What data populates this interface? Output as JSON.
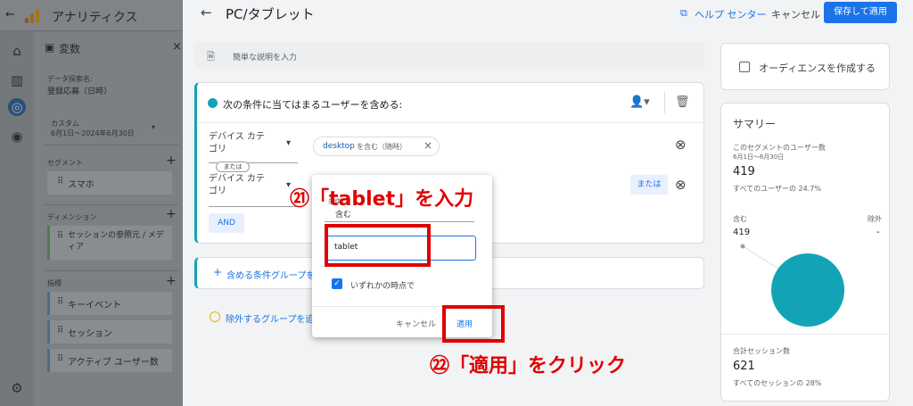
{
  "app": {
    "back_glyph": "←",
    "title": "アナリティクス",
    "variables_title": "変数",
    "close_glyph": "×",
    "dataset_label": "データ探索名:",
    "dataset_value": "登録応募（日時）",
    "custom_label": "カスタム",
    "date_range": "6月1日～2024年6月30日",
    "segments_label": "セグメント",
    "segment_item": "スマホ",
    "dimensions_label": "ディメンション",
    "dimension_item": "セッションの参照元 / メディア",
    "metrics_label": "指標",
    "metric_items": [
      "キーイベント",
      "セッション",
      "アクティブ ユーザー数"
    ]
  },
  "header": {
    "back_glyph": "←",
    "title": "PC/タブレット",
    "help_label": "ヘルプ センター",
    "cancel_label": "キャンセル",
    "save_label": "保存して適用"
  },
  "description": {
    "placeholder": "簡単な説明を入力"
  },
  "condition": {
    "title": "次の条件に当てはまるユーザーを含める:",
    "dimension_1": "デバイス カテゴリ",
    "dimension_2": "デバイス カテゴリ",
    "chip_text": "desktop",
    "chip_suffix": "を含む（随時）",
    "or_badge": "または",
    "or_button": "または",
    "and_button": "AND"
  },
  "include_group": "含める条件グループを追加",
  "exclude_group": "除外するグループを追加",
  "popup": {
    "condition_type_label": "条件",
    "condition_type_value": "含む",
    "value_input": "tablet",
    "checkbox_label": "いずれかの時点で",
    "cancel_label": "キャンセル",
    "apply_label": "適用"
  },
  "annotations": {
    "step21": "㉑「tablet」を入力",
    "step22": "㉒「適用」をクリック"
  },
  "audience": {
    "label": "オーディエンスを作成する"
  },
  "summary": {
    "title": "サマリー",
    "users_label": "このセグメントのユーザー数",
    "users_range": "6月1日～6月30日",
    "users_value": "419",
    "users_share": "すべてのユーザーの 24.7%",
    "include_label": "含む",
    "exclude_label": "除外",
    "include_value": "419",
    "exclude_value": "-",
    "sessions_label": "合計セッション数",
    "sessions_value": "621",
    "sessions_share": "すべてのセッションの 28%"
  },
  "colors": {
    "accent": "#1a73e8",
    "teal": "#12a4b6",
    "annotation_red": "#e00000"
  }
}
